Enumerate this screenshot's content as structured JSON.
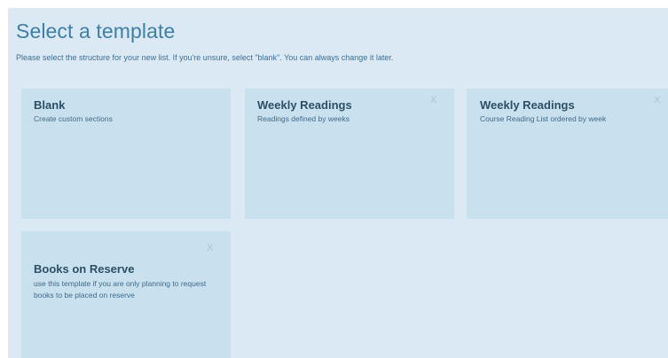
{
  "page": {
    "title": "Select a template",
    "subtitle": "Please select the structure for your new list. If you're unsure, select \"blank\". You can always change it later."
  },
  "templates": [
    {
      "title": "Blank",
      "description": "Create custom sections"
    },
    {
      "title": "Weekly Readings",
      "description": "Readings defined by weeks",
      "remove_icon": "X"
    },
    {
      "title": "Weekly Readings",
      "description": "Course Reading List ordered by week",
      "remove_icon": "X"
    },
    {
      "title": "Books on Reserve",
      "description": "use this template if you are only planning to request books to be placed on reserve",
      "remove_icon": "X"
    }
  ],
  "colors": {
    "background": "#dbe9f4",
    "card": "#c9e0ee",
    "title": "#3e7fa7",
    "card_title": "#2c4f66"
  }
}
